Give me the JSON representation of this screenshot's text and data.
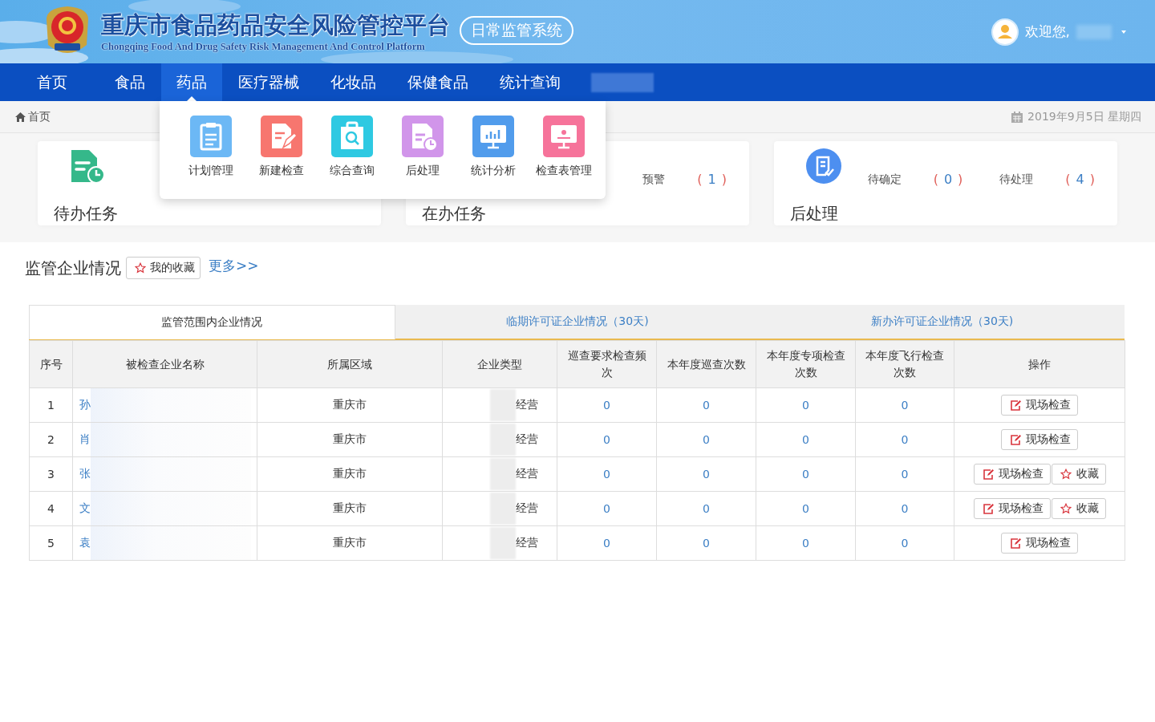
{
  "header": {
    "title": "重庆市食品药品安全风险管控平台",
    "subtitle": "Chongqing Food And Drug Safety Risk Management And Control Platform",
    "system": "日常监管系统",
    "welcome": "欢迎您,"
  },
  "nav": {
    "items": [
      {
        "label": "首页",
        "selected": false
      },
      {
        "label": "食品",
        "selected": false
      },
      {
        "label": "药品",
        "selected": true
      },
      {
        "label": "医疗器械",
        "selected": false
      },
      {
        "label": "化妆品",
        "selected": false
      },
      {
        "label": "保健食品",
        "selected": false
      },
      {
        "label": "统计查询",
        "selected": false
      }
    ],
    "dropdown": [
      {
        "kind": "plan",
        "label": "计划管理",
        "color": "#6cb8f5"
      },
      {
        "kind": "new",
        "label": "新建检查",
        "color": "#f7766f"
      },
      {
        "kind": "query",
        "label": "综合查询",
        "color": "#2ec9e2"
      },
      {
        "kind": "post",
        "label": "后处理",
        "color": "#d195ea"
      },
      {
        "kind": "stats",
        "label": "统计分析",
        "color": "#519cec"
      },
      {
        "kind": "form",
        "label": "检查表管理",
        "color": "#f6739a"
      }
    ]
  },
  "breadcrumb": {
    "home": "首页",
    "date": "2019年9月5日 星期四"
  },
  "cards": [
    {
      "kind": "todo",
      "title": "待办任务"
    },
    {
      "kind": "doing",
      "title": "在办任务",
      "stats": [
        {
          "label": "预警",
          "open": "(",
          "count": "1",
          "close": ")"
        }
      ]
    },
    {
      "kind": "post",
      "title": "后处理",
      "stats": [
        {
          "label": "待确定",
          "open": "(",
          "count": "0",
          "close": ")"
        },
        {
          "label": "待处理",
          "open": "(",
          "count": "4",
          "close": ")"
        }
      ]
    }
  ],
  "section": {
    "title": "监管企业情况",
    "favorites": "我的收藏",
    "more": "更多>>"
  },
  "table_tabs": [
    {
      "label": "监管范围内企业情况",
      "selected": true
    },
    {
      "label": "临期许可证企业情况（30天)",
      "selected": false
    },
    {
      "label": "新办许可证企业情况（30天)",
      "selected": false
    }
  ],
  "table": {
    "columns": [
      "序号",
      "被检查企业名称",
      "所属区域",
      "企业类型",
      "巡查要求检查频次",
      "本年度巡查次数",
      "本年度专项检查次数",
      "本年度飞行检查次数",
      "操作"
    ],
    "rows": [
      {
        "no": "1",
        "name": "孙",
        "region": "重庆市",
        "type": "经营",
        "freq": "0",
        "patrol": "0",
        "special": "0",
        "flight": "0",
        "actions": [
          {
            "kind": "inspect",
            "label": "现场检查"
          }
        ]
      },
      {
        "no": "2",
        "name": "肖",
        "region": "重庆市",
        "type": "经营",
        "freq": "0",
        "patrol": "0",
        "special": "0",
        "flight": "0",
        "actions": [
          {
            "kind": "inspect",
            "label": "现场检查"
          }
        ]
      },
      {
        "no": "3",
        "name": "张",
        "region": "重庆市",
        "type": "经营",
        "freq": "0",
        "patrol": "0",
        "special": "0",
        "flight": "0",
        "actions": [
          {
            "kind": "inspect",
            "label": "现场检查"
          },
          {
            "kind": "favorite",
            "label": "收藏"
          }
        ]
      },
      {
        "no": "4",
        "name": "文",
        "region": "重庆市",
        "type": "经营",
        "freq": "0",
        "patrol": "0",
        "special": "0",
        "flight": "0",
        "actions": [
          {
            "kind": "inspect",
            "label": "现场检查"
          },
          {
            "kind": "favorite",
            "label": "收藏"
          }
        ]
      },
      {
        "no": "5",
        "name": "袁",
        "region": "重庆市",
        "type": "经营",
        "freq": "0",
        "patrol": "0",
        "special": "0",
        "flight": "0",
        "actions": [
          {
            "kind": "inspect",
            "label": "现场检查"
          }
        ]
      }
    ]
  }
}
